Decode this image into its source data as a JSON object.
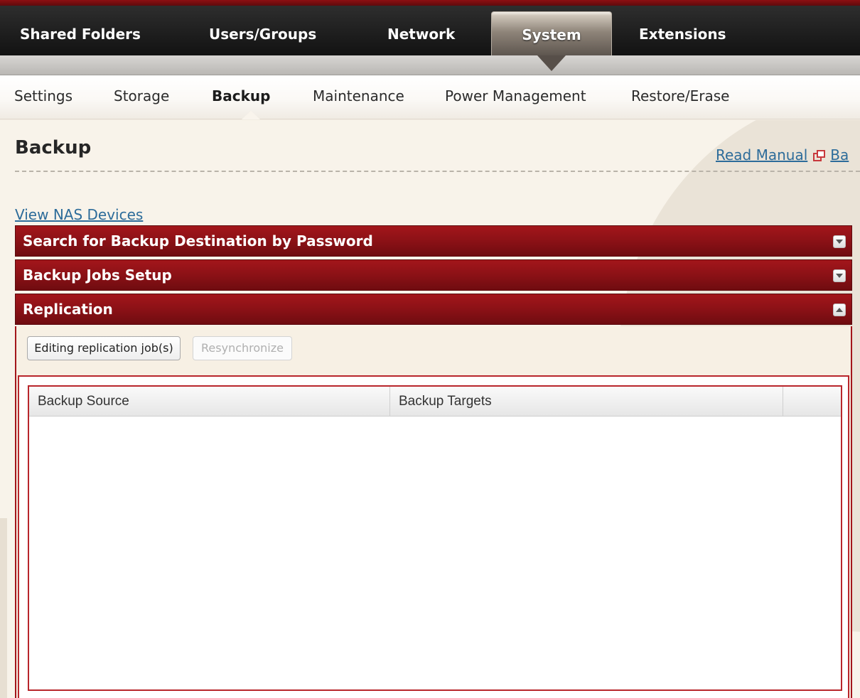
{
  "top_nav": {
    "items": [
      {
        "label": "Shared Folders",
        "icon": ""
      },
      {
        "label": "Users/Groups",
        "icon": ""
      },
      {
        "label": "Network",
        "icon": ""
      },
      {
        "label": "System",
        "icon": "",
        "active": true
      },
      {
        "label": "Extensions",
        "icon": ""
      }
    ]
  },
  "sub_nav": {
    "items": [
      {
        "label": "Settings"
      },
      {
        "label": "Storage"
      },
      {
        "label": "Backup",
        "active": true
      },
      {
        "label": "Maintenance"
      },
      {
        "label": "Power Management"
      },
      {
        "label": "Restore/Erase"
      }
    ]
  },
  "page": {
    "title": "Backup",
    "read_manual": "Read Manual",
    "back_link": "Ba",
    "view_nas": "View NAS Devices"
  },
  "panels": [
    {
      "title": "Search for Backup Destination by Password",
      "icon": "expand-icon"
    },
    {
      "title": "Backup Jobs Setup",
      "icon": "expand-icon"
    },
    {
      "title": "Replication",
      "icon": "collapse-icon"
    }
  ],
  "replication": {
    "edit_button": "Editing replication job(s)",
    "resync_button": "Resynchronize",
    "columns": [
      "Backup Source",
      "Backup Targets",
      ""
    ]
  },
  "colors": {
    "brand_red": "#8b1116",
    "nav_dark": "#1e1e1e",
    "link_blue": "#2d6c9a"
  }
}
